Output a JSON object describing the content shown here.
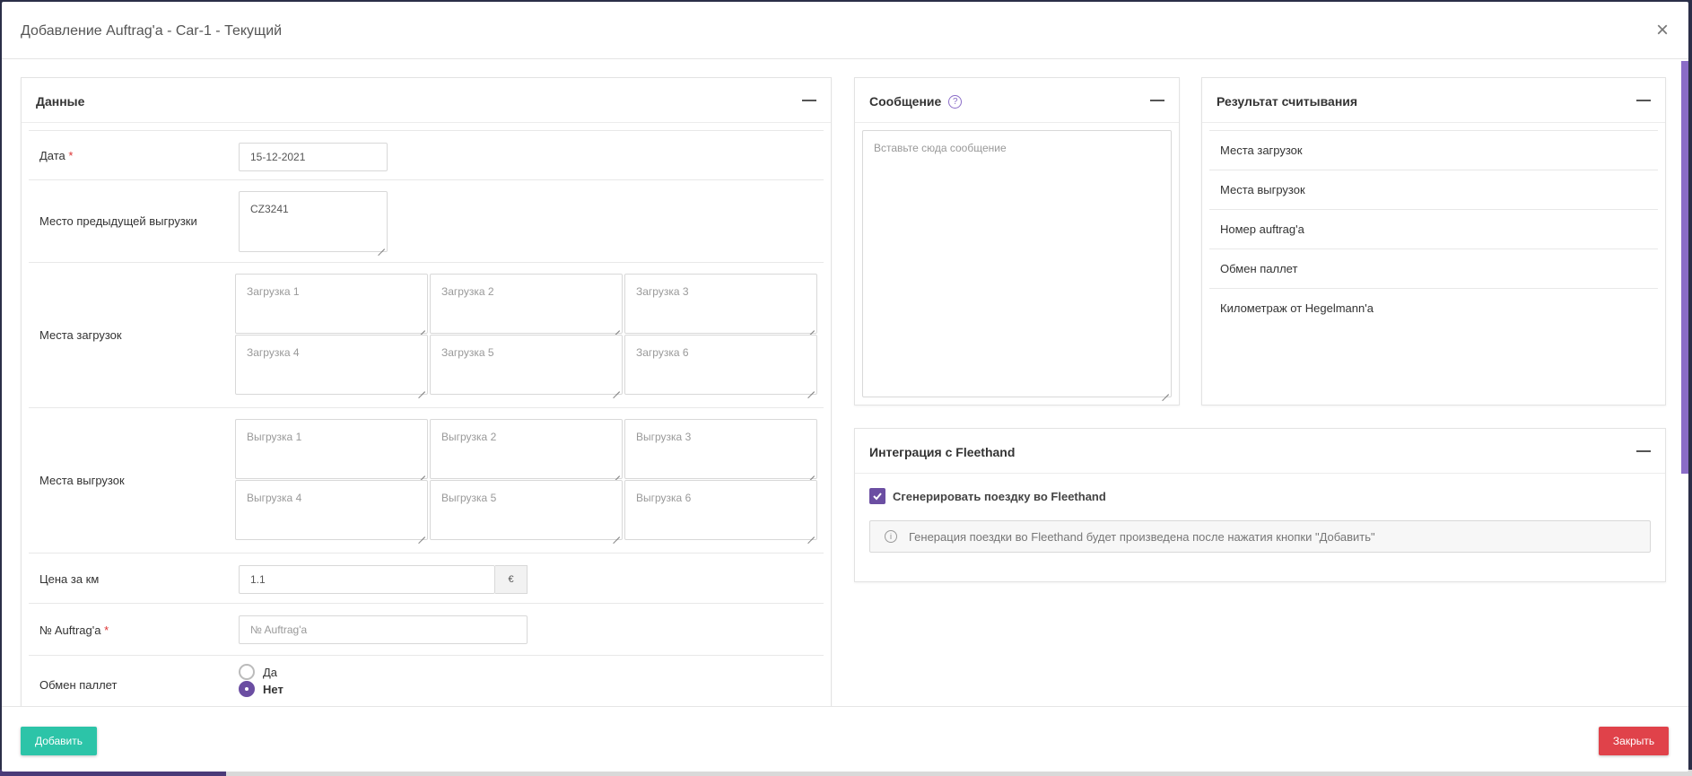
{
  "modal": {
    "title": "Добавление Auftrag'a - Car-1 - Текущий",
    "close_icon": "×"
  },
  "data_panel": {
    "title": "Данные",
    "date_label": "Дата",
    "required_mark": "*",
    "date_value": "15-12-2021",
    "prev_unload_label": "Место предыдущей выгрузки",
    "prev_unload_value": "CZ3241",
    "loading_label": "Места загрузок",
    "loading_placeholders": [
      "Загрузка 1",
      "Загрузка 2",
      "Загрузка 3",
      "Загрузка 4",
      "Загрузка 5",
      "Загрузка 6"
    ],
    "unloading_label": "Места выгрузок",
    "unloading_placeholders": [
      "Выгрузка 1",
      "Выгрузка 2",
      "Выгрузка 3",
      "Выгрузка 4",
      "Выгрузка 5",
      "Выгрузка 6"
    ],
    "price_label": "Цена за км",
    "price_value": "1.1",
    "currency": "€",
    "auftrag_label": "№ Auftrag'a",
    "auftrag_placeholder": "№ Auftrag'a",
    "pallet_label": "Обмен паллет",
    "pallet_options": [
      "Да",
      "Нет"
    ],
    "pallet_selected": "Нет"
  },
  "message_panel": {
    "title": "Сообщение",
    "help_icon": "?",
    "placeholder": "Вставьте сюда сообщение"
  },
  "result_panel": {
    "title": "Результат считывания",
    "items": [
      "Места загрузок",
      "Места выгрузок",
      "Номер auftrag'a",
      "Обмен паллет",
      "Километраж от Hegelmann'a"
    ]
  },
  "fleethand_panel": {
    "title": "Интеграция с Fleethand",
    "checkbox_label": "Сгенерировать поездку во Fleethand",
    "checkbox_checked": true,
    "info_text": "Генерация поездки во Fleethand будет произведена после нажатия кнопки \"Добавить\""
  },
  "footer": {
    "add_label": "Добавить",
    "close_label": "Закрыть"
  },
  "colors": {
    "accent": "#6b4ea2",
    "add_button": "#2cc4a8",
    "close_button": "#e0424a"
  }
}
